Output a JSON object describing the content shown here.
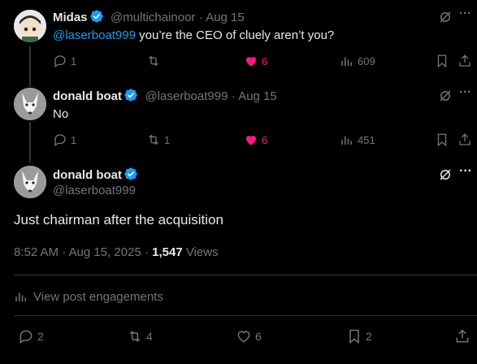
{
  "tweets": [
    {
      "name": "Midas",
      "handle": "@multichainoor",
      "date": "· Aug 15",
      "mention": "@laserboat999",
      "text": " you’re the CEO of cluely aren’t you?",
      "replies": "1",
      "retweets": "",
      "likes": "6",
      "views": "609"
    },
    {
      "name": "donald boat",
      "handle": "@laserboat999",
      "date": "· Aug 15",
      "text": "No",
      "replies": "1",
      "retweets": "1",
      "likes": "6",
      "views": "451"
    }
  ],
  "main_post": {
    "name": "donald boat",
    "handle": "@laserboat999",
    "text": "Just chairman after the acquisition",
    "time": "8:52 AM · Aug 15, 2025 · ",
    "views_count": "1,547",
    "views_label": " Views",
    "engagements_label": "View post engagements",
    "replies": "2",
    "retweets": "4",
    "likes": "6",
    "bookmarks": "2"
  },
  "colors": {
    "accent": "#1d9bf0",
    "like": "#f91880",
    "muted": "#71767b",
    "background": "#000000"
  }
}
